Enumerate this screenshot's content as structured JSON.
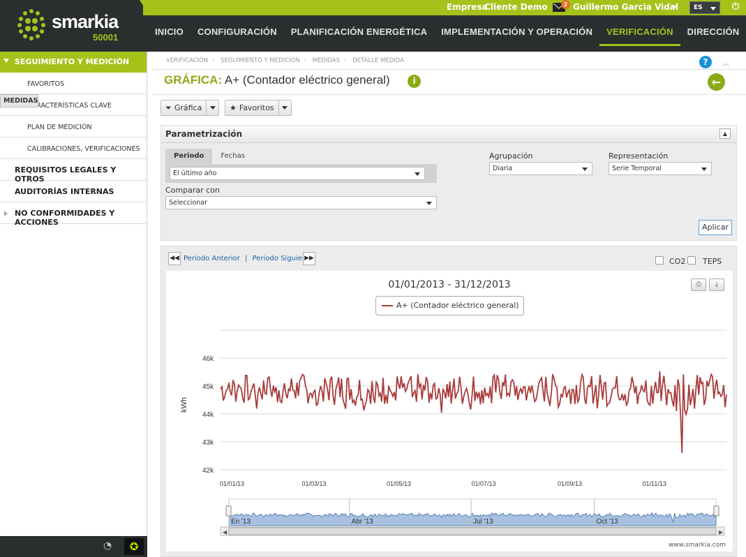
{
  "header": {
    "logo_text": "smarkia",
    "logo_sub": "50001",
    "empresa_label": "Empresa",
    "empresa_value": "Cliente Demo",
    "notifications": "2",
    "user": "Guillermo Garcia Vidal",
    "lang": "ES",
    "nav": [
      "INICIO",
      "CONFIGURACIÓN",
      "PLANIFICACIÓN ENERGÉTICA",
      "IMPLEMENTACIÓN Y OPERACIÓN",
      "VERIFICACIÓN",
      "DIRECCIÓN"
    ],
    "nav_active": "VERIFICACIÓN"
  },
  "sidebar": {
    "section": "SEGUIMIENTO Y MEDICIÓN",
    "subitems": [
      "FAVORITOS",
      "MEDIDAS",
      "CARACTERÍSTICAS CLAVE",
      "PLAN DE MEDICIÓN",
      "CALIBRACIONES, VERIFICACIONES"
    ],
    "selected": "MEDIDAS",
    "main_items": [
      "REQUISITOS LEGALES Y OTROS",
      "AUDITORÍAS INTERNAS",
      "NO CONFORMIDADES Y ACCIONES"
    ]
  },
  "breadcrumb": [
    "VERIFICACIÓN",
    "SEGUIMIENTO Y MEDICIÓN",
    "MEDIDAS",
    "DETALLE MEDIDA"
  ],
  "page": {
    "title_key": "GRÁFICA:",
    "title_value": "A+ (Contador eléctrico general)"
  },
  "toolbar": {
    "grafica": "Gráfica",
    "favoritos": "Favoritos"
  },
  "param": {
    "title": "Parametrización",
    "tab_periodo": "Periodo",
    "tab_fechas": "Fechas",
    "periodo_value": "El último año",
    "comparar_label": "Comparar con",
    "comparar_value": "Seleccionar",
    "agrupacion_label": "Agrupación",
    "agrupacion_value": "Diaria",
    "representacion_label": "Representación",
    "representacion_value": "Serie Temporal",
    "apply": "Aplicar"
  },
  "chart_nav": {
    "prev": "Periodo Anterior",
    "sep": "|",
    "next": "Periodo Siguiente",
    "co2": "CO2",
    "teps": "TEPS"
  },
  "chart_data": {
    "type": "line",
    "title": "01/01/2013 - 31/12/2013",
    "ylabel": "kWh",
    "ylim": [
      41800,
      47000
    ],
    "yticks": [
      "42k",
      "43k",
      "44k",
      "45k",
      "46k"
    ],
    "ytick_values": [
      42000,
      43000,
      44000,
      45000,
      46000
    ],
    "xticks": [
      "01/01/13",
      "01/03/13",
      "01/05/13",
      "01/07/13",
      "01/09/13",
      "01/11/13"
    ],
    "navigator_ticks": [
      "En '13",
      "Abr '13",
      "Jul '13",
      "Oct '13"
    ],
    "series": [
      {
        "name": "A+ (Contador eléctrico general)",
        "color": "#a83c3c"
      }
    ],
    "x_start": "2013-01-01",
    "x_end": "2013-12-31",
    "interval": "daily",
    "values": []
  },
  "credit": "www.smarkia.com"
}
